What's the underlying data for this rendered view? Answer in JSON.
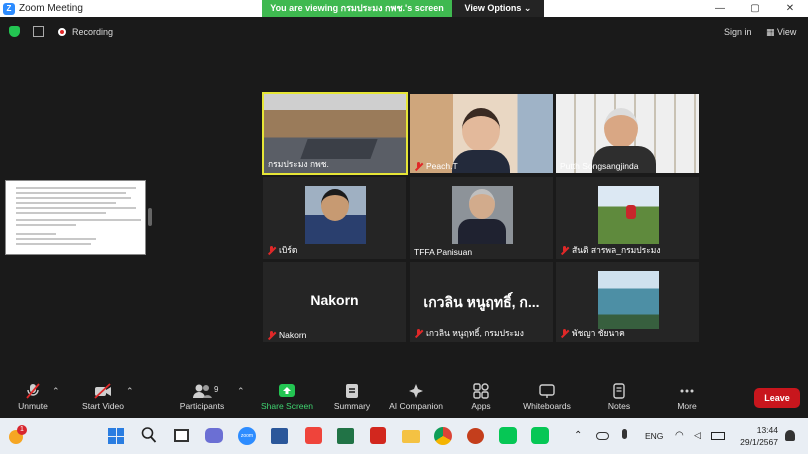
{
  "titlebar": {
    "app_title": "Zoom Meeting",
    "logo_letter": "Z"
  },
  "banner": {
    "message": "You are viewing กรมประมง กพช.'s screen",
    "view_options": "View Options ⌄"
  },
  "window_controls": {
    "minimize": "—",
    "restore": "▢",
    "close": "✕"
  },
  "header": {
    "recording": "Recording",
    "sign_in": "Sign in",
    "view": "View",
    "view_icon": "▦"
  },
  "participants": [
    {
      "name": "กรมประมง กพช.",
      "muted": false
    },
    {
      "name": "Peach.T",
      "muted": true
    },
    {
      "name": "Putth Songsangjinda",
      "muted": false
    },
    {
      "name": "เบิร์ด",
      "muted": true
    },
    {
      "name": "TFFA Panisuan",
      "muted": false
    },
    {
      "name": "สันติ สารพล_กรมประมง",
      "muted": true
    },
    {
      "name": "Nakorn",
      "muted": true,
      "display_text": "Nakorn"
    },
    {
      "name": "เกวลิน หนูฤทธิ์, กรมประมง",
      "muted": true,
      "display_text": "เกวลิน หนูฤทธิ์, ก..."
    },
    {
      "name": "พัชญา ชัยนาค",
      "muted": true
    }
  ],
  "toolbar": {
    "unmute": "Unmute",
    "start_video": "Start Video",
    "participants": "Participants",
    "participants_count": "9",
    "share_screen": "Share Screen",
    "summary": "Summary",
    "ai_companion": "AI Companion",
    "apps": "Apps",
    "whiteboards": "Whiteboards",
    "notes": "Notes",
    "more": "More",
    "leave": "Leave"
  },
  "taskbar": {
    "notification_count": "1",
    "language": "ENG",
    "time": "13:44",
    "date": "29/1/2567"
  },
  "colors": {
    "accent_green": "#3fb950",
    "share_green": "#23c552",
    "leave_red": "#c8161d",
    "active_border": "#e6e637"
  }
}
